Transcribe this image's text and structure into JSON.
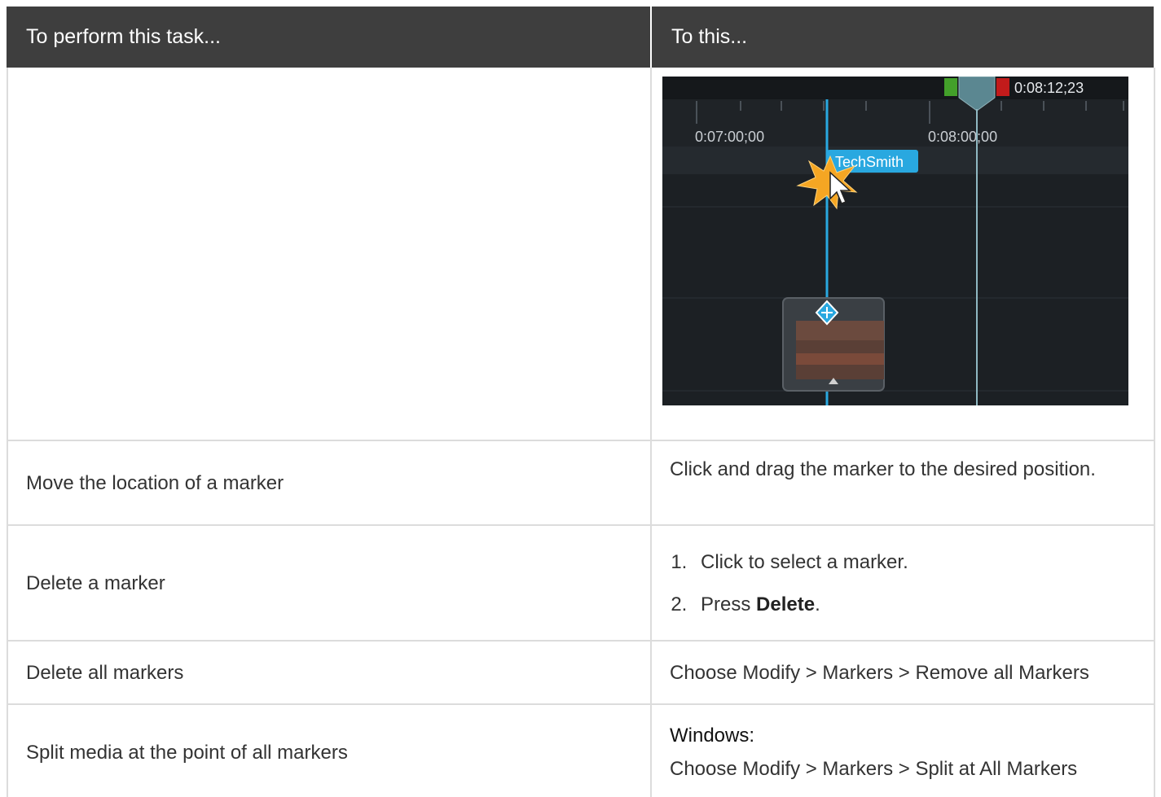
{
  "table": {
    "headers": [
      "To perform this task...",
      "To this..."
    ],
    "rows": [
      {
        "task": "",
        "action": ""
      },
      {
        "task": "Move the location of a marker",
        "action": "Click and drag the marker to the desired position."
      },
      {
        "task": "Delete a marker",
        "steps": [
          "Click to select a marker.",
          "Press "
        ],
        "step2_bold": "Delete",
        "step2_suffix": "."
      },
      {
        "task": "Delete all markers",
        "action": "Choose Modify > Markers > Remove all Markers"
      },
      {
        "task": "Split media at the point of all markers",
        "platform": "Windows:",
        "action": "Choose Modify > Markers > Split at All Markers"
      }
    ]
  },
  "screenshot": {
    "playhead_time": "0:08:12;23",
    "tick_label_1": "0:07:00;00",
    "tick_label_2": "0:08:00;00",
    "marker_label": "TechSmith"
  },
  "colors": {
    "header_bg": "#3e3e3e",
    "grid": "#dcdcdc",
    "timeline_bg": "#1c2024",
    "marker_blue": "#29a8e0"
  }
}
